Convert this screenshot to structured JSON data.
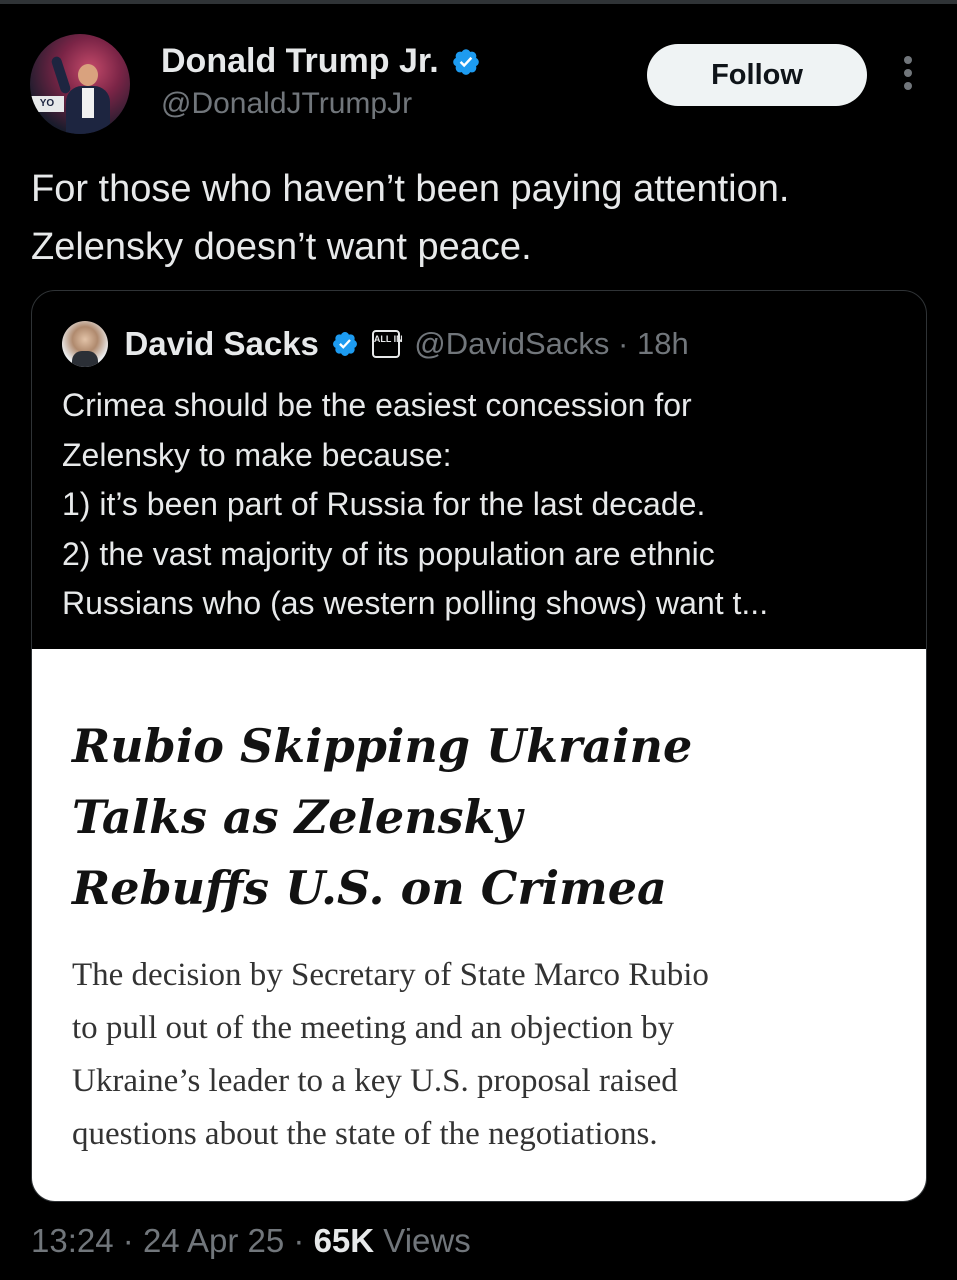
{
  "author": {
    "display_name": "Donald Trump Jr.",
    "handle": "@DonaldJTrumpJr",
    "avatar_sign": "YO"
  },
  "actions": {
    "follow_label": "Follow",
    "more_icon": "more-vertical-icon"
  },
  "tweet": {
    "text": "For those who haven’t been paying attention. Zelensky doesn’t want peace."
  },
  "quoted": {
    "display_name": "David Sacks",
    "affiliation_badge": "ALL IN",
    "handle_time": "@DavidSacks · 18h",
    "text_lines": [
      "Crimea should be the easiest concession for",
      "Zelensky to make because:",
      "1) it’s been part of Russia for the last decade.",
      "2) the vast majority of its population are ethnic",
      "Russians who (as western polling shows) want t..."
    ],
    "article": {
      "headline_lines": [
        "Rubio Skipping Ukraine",
        "Talks as Zelensky",
        "Rebuffs U.S. on Crimea"
      ],
      "summary_lines": [
        "The decision by Secretary of State Marco Rubio",
        "to pull out of the meeting and an objection by",
        "Ukraine’s leader to a key U.S. proposal raised",
        "questions about the state of the negotiations."
      ]
    }
  },
  "footer": {
    "time": "13:24",
    "sep": "·",
    "date": "24 Apr 25",
    "views_count": "65K",
    "views_label": "Views"
  },
  "colors": {
    "background": "#000000",
    "text_primary": "#e7e9ea",
    "text_secondary": "#71767b",
    "verified": "#1d9bf0",
    "border": "#2f3336"
  }
}
